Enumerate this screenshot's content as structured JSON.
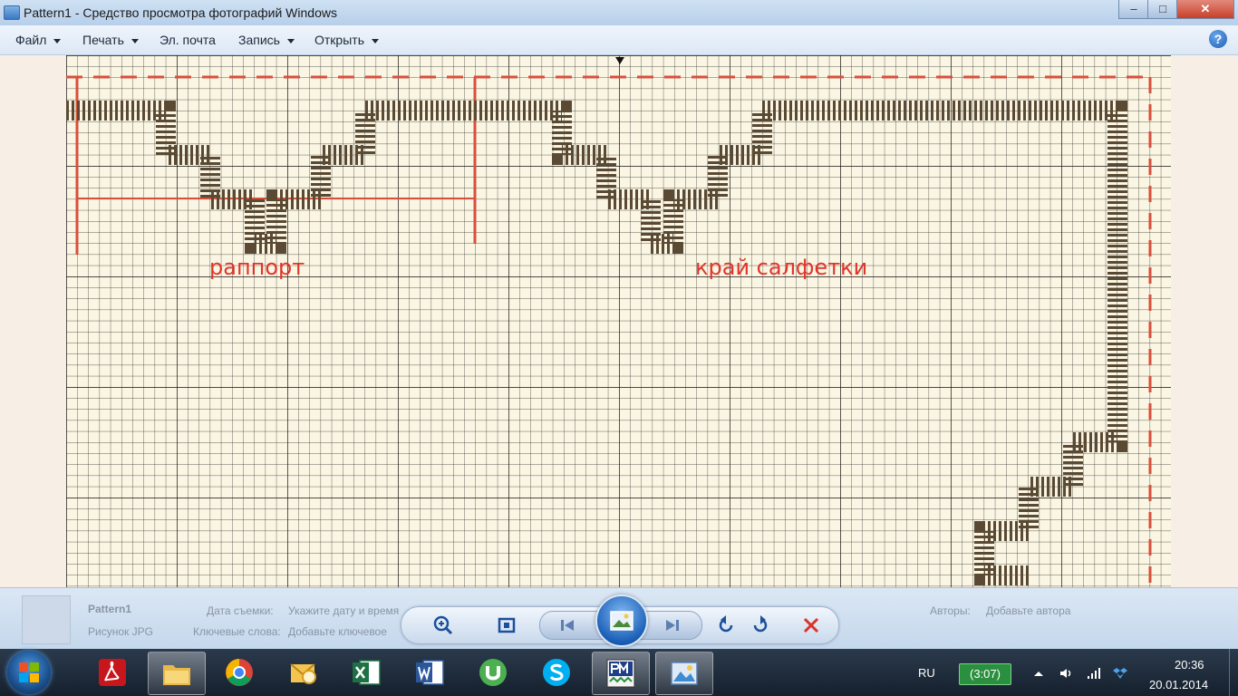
{
  "window": {
    "title": "Pattern1 - Средство просмотра фотографий Windows",
    "controls": {
      "minimize": "–",
      "maximize": "□",
      "close": "✕"
    }
  },
  "menu": {
    "file": "Файл",
    "print": "Печать",
    "email": "Эл. почта",
    "burn": "Запись",
    "open": "Открыть",
    "help": "?"
  },
  "pattern": {
    "label_repeat": "раппорт",
    "label_edge": "край салфетки",
    "colors": {
      "paper": "#fbf6e3",
      "grid_minor": "#1f1f1f",
      "stitch": "#5a4a33",
      "guide": "#d7503c"
    }
  },
  "info_panel": {
    "name": "Pattern1",
    "date_label": "Дата съемки:",
    "date_value": "Укажите дату и время",
    "type_line": "Рисунок JPG",
    "keywords_label": "Ключевые слова:",
    "keywords_value": "Добавьте ключевое",
    "authors_label": "Авторы:",
    "authors_value": "Добавьте автора"
  },
  "viewer_controls": [
    "zoom-icon",
    "fit-icon",
    "previous-icon",
    "slideshow-icon",
    "next-icon",
    "rotate-left-icon",
    "rotate-right-icon",
    "delete-icon"
  ],
  "taskbar": {
    "apps": [
      "adobe-reader-icon",
      "folder-icon",
      "chrome-icon",
      "outlook-icon",
      "excel-icon",
      "word-icon",
      "utorrent-icon",
      "skype-icon",
      "pattern-maker-icon",
      "photo-viewer-icon"
    ],
    "language": "RU",
    "battery": "(3:07)",
    "time": "20:36",
    "date": "20.01.2014"
  }
}
